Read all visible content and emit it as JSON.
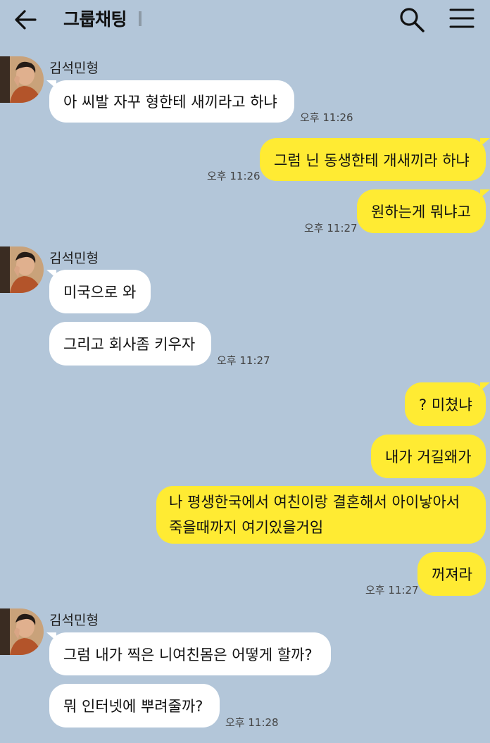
{
  "header": {
    "title": "그룹채팅"
  },
  "sender_name": "김석민형",
  "messages": [
    {
      "text": "아 씨발 자꾸 형한테 새끼라고 하냐",
      "time": "오후 11:26"
    },
    {
      "text": "그럼 닌 동생한테 개새끼라 하냐",
      "time": "오후 11:26"
    },
    {
      "text": "원하는게 뭐냐고",
      "time": "오후 11:27"
    },
    {
      "text": "미국으로 와"
    },
    {
      "text": "그리고 회사좀 키우자",
      "time": "오후 11:27"
    },
    {
      "text": "? 미쳤냐"
    },
    {
      "text": "내가 거길왜가"
    },
    {
      "text": "나 평생한국에서 여친이랑 결혼해서 아이낳아서 죽을때까지 여기있을거임"
    },
    {
      "text": "꺼져라",
      "time": "오후 11:27"
    },
    {
      "text": "그럼 내가 찍은 니여친몸은 어떻게 할까?"
    },
    {
      "text": "뭐 인터넷에 뿌려줄까?",
      "time": "오후 11:28"
    }
  ]
}
